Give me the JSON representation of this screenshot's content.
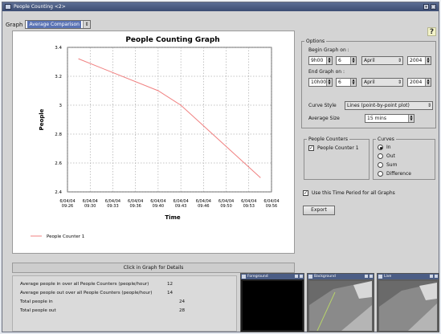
{
  "window": {
    "title": "People Counting <2>"
  },
  "graph_selector": {
    "label": "Graph",
    "value": "Average Comparison"
  },
  "help": {
    "label": "?"
  },
  "chart_data": {
    "type": "line",
    "title": "People Counting Graph",
    "xlabel": "Time",
    "ylabel": "People",
    "x_ticks": [
      [
        "6/04/04",
        "09:26"
      ],
      [
        "6/04/04",
        "09:30"
      ],
      [
        "6/04/04",
        "09:33"
      ],
      [
        "6/04/04",
        "09:36"
      ],
      [
        "6/04/04",
        "09:40"
      ],
      [
        "6/04/04",
        "09:43"
      ],
      [
        "6/04/04",
        "09:46"
      ],
      [
        "6/04/04",
        "09:50"
      ],
      [
        "6/04/04",
        "09:53"
      ],
      [
        "6/04/04",
        "09:56"
      ]
    ],
    "y_ticks": [
      "2.4",
      "2.6",
      "2.8",
      "3",
      "3.2",
      "3.4"
    ],
    "ylim": [
      2.4,
      3.4
    ],
    "grid": true,
    "legend_position": "bottom-left",
    "series": [
      {
        "name": "People Counter 1",
        "color": "#f08080",
        "points": [
          {
            "x_index": 0.5,
            "y": 3.32
          },
          {
            "x_index": 4.0,
            "y": 3.1
          },
          {
            "x_index": 5.0,
            "y": 3.0
          },
          {
            "x_index": 8.5,
            "y": 2.5
          }
        ]
      }
    ]
  },
  "click_bar": {
    "label": "Click in Graph for Details"
  },
  "stats": [
    {
      "label": "Average people in over all People Counters (people/hour)",
      "value": "12"
    },
    {
      "label": "Average people out over all People Counters (people/hour)",
      "value": "14"
    },
    {
      "label": "Total people in",
      "value": "24"
    },
    {
      "label": "Total people out",
      "value": "28"
    }
  ],
  "options": {
    "legend": "Options",
    "begin_label": "Begin Graph on :",
    "begin": {
      "time": "9h00",
      "day": "6",
      "month": "April",
      "year": "2004"
    },
    "end_label": "End Graph on :",
    "end": {
      "time": "10h00",
      "day": "6",
      "month": "April",
      "year": "2004"
    },
    "curve_style_label": "Curve Style",
    "curve_style": "Lines (point-by-point plot)",
    "average_size_label": "Average Size",
    "average_size": "15 mins"
  },
  "people_counters": {
    "legend": "People Counters",
    "items": [
      {
        "label": "People Counter 1",
        "checked": true
      }
    ]
  },
  "curves": {
    "legend": "Curves",
    "items": [
      {
        "label": "In",
        "selected": true
      },
      {
        "label": "Out",
        "selected": false
      },
      {
        "label": "Sum",
        "selected": false
      },
      {
        "label": "Difference",
        "selected": false
      }
    ]
  },
  "use_time_period": {
    "label": "Use this Time Period for all Graphs",
    "checked": true
  },
  "export": {
    "label": "Export"
  },
  "thumbnails": [
    {
      "title": "Foreground"
    },
    {
      "title": "Background"
    },
    {
      "title": "Live"
    }
  ]
}
